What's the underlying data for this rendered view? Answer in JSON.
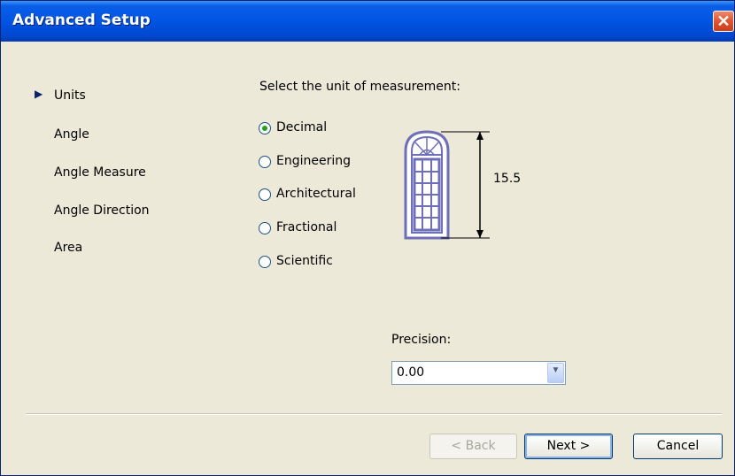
{
  "window": {
    "title": "Advanced Setup",
    "close_label": "✕"
  },
  "nav": {
    "items": [
      {
        "label": "Units",
        "active": true
      },
      {
        "label": "Angle",
        "active": false
      },
      {
        "label": "Angle Measure",
        "active": false
      },
      {
        "label": "Angle Direction",
        "active": false
      },
      {
        "label": "Area",
        "active": false
      }
    ]
  },
  "units": {
    "heading": "Select the unit of measurement:",
    "options": [
      {
        "label": "Decimal",
        "selected": true
      },
      {
        "label": "Engineering",
        "selected": false
      },
      {
        "label": "Architectural",
        "selected": false
      },
      {
        "label": "Fractional",
        "selected": false
      },
      {
        "label": "Scientific",
        "selected": false
      }
    ],
    "preview_dimension": "15.5"
  },
  "precision": {
    "label": "Precision:",
    "value": "0.00"
  },
  "buttons": {
    "back": "< Back",
    "next": "Next >",
    "cancel": "Cancel"
  },
  "colors": {
    "title_bar": "#0054e3",
    "dialog_bg": "#ece9d8",
    "window_frame": "#6e6fb8",
    "radio_dot": "#21a121"
  }
}
